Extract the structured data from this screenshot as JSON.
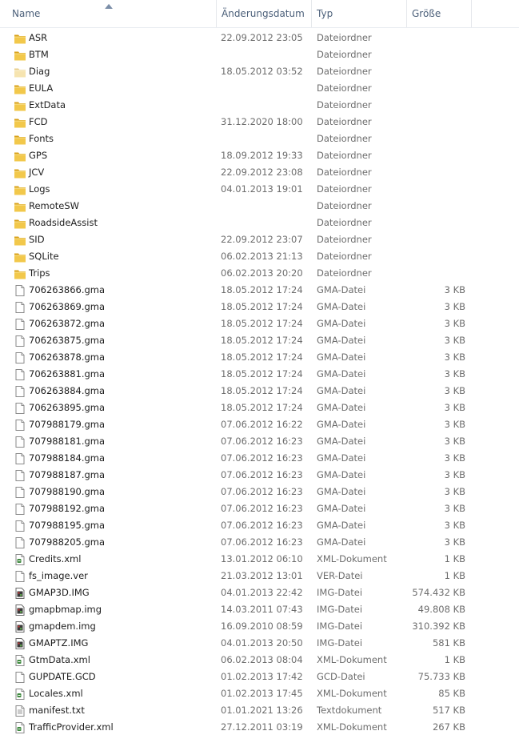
{
  "columns": {
    "name": "Name",
    "date": "Änderungsdatum",
    "type": "Typ",
    "size": "Größe"
  },
  "files": [
    {
      "name": "ASR",
      "date": "22.09.2012 23:05",
      "type": "Dateiordner",
      "size": "",
      "icon": "folder"
    },
    {
      "name": "BTM",
      "date": "",
      "type": "Dateiordner",
      "size": "",
      "icon": "folder"
    },
    {
      "name": "Diag",
      "date": "18.05.2012 03:52",
      "type": "Dateiordner",
      "size": "",
      "icon": "folder-light"
    },
    {
      "name": "EULA",
      "date": "",
      "type": "Dateiordner",
      "size": "",
      "icon": "folder"
    },
    {
      "name": "ExtData",
      "date": "",
      "type": "Dateiordner",
      "size": "",
      "icon": "folder"
    },
    {
      "name": "FCD",
      "date": "31.12.2020 18:00",
      "type": "Dateiordner",
      "size": "",
      "icon": "folder"
    },
    {
      "name": "Fonts",
      "date": "",
      "type": "Dateiordner",
      "size": "",
      "icon": "folder"
    },
    {
      "name": "GPS",
      "date": "18.09.2012 19:33",
      "type": "Dateiordner",
      "size": "",
      "icon": "folder"
    },
    {
      "name": "JCV",
      "date": "22.09.2012 23:08",
      "type": "Dateiordner",
      "size": "",
      "icon": "folder"
    },
    {
      "name": "Logs",
      "date": "04.01.2013 19:01",
      "type": "Dateiordner",
      "size": "",
      "icon": "folder"
    },
    {
      "name": "RemoteSW",
      "date": "",
      "type": "Dateiordner",
      "size": "",
      "icon": "folder"
    },
    {
      "name": "RoadsideAssist",
      "date": "",
      "type": "Dateiordner",
      "size": "",
      "icon": "folder"
    },
    {
      "name": "SID",
      "date": "22.09.2012 23:07",
      "type": "Dateiordner",
      "size": "",
      "icon": "folder"
    },
    {
      "name": "SQLite",
      "date": "06.02.2013 21:13",
      "type": "Dateiordner",
      "size": "",
      "icon": "folder"
    },
    {
      "name": "Trips",
      "date": "06.02.2013 20:20",
      "type": "Dateiordner",
      "size": "",
      "icon": "folder"
    },
    {
      "name": "706263866.gma",
      "date": "18.05.2012 17:24",
      "type": "GMA-Datei",
      "size": "3 KB",
      "icon": "file"
    },
    {
      "name": "706263869.gma",
      "date": "18.05.2012 17:24",
      "type": "GMA-Datei",
      "size": "3 KB",
      "icon": "file"
    },
    {
      "name": "706263872.gma",
      "date": "18.05.2012 17:24",
      "type": "GMA-Datei",
      "size": "3 KB",
      "icon": "file"
    },
    {
      "name": "706263875.gma",
      "date": "18.05.2012 17:24",
      "type": "GMA-Datei",
      "size": "3 KB",
      "icon": "file"
    },
    {
      "name": "706263878.gma",
      "date": "18.05.2012 17:24",
      "type": "GMA-Datei",
      "size": "3 KB",
      "icon": "file"
    },
    {
      "name": "706263881.gma",
      "date": "18.05.2012 17:24",
      "type": "GMA-Datei",
      "size": "3 KB",
      "icon": "file"
    },
    {
      "name": "706263884.gma",
      "date": "18.05.2012 17:24",
      "type": "GMA-Datei",
      "size": "3 KB",
      "icon": "file"
    },
    {
      "name": "706263895.gma",
      "date": "18.05.2012 17:24",
      "type": "GMA-Datei",
      "size": "3 KB",
      "icon": "file"
    },
    {
      "name": "707988179.gma",
      "date": "07.06.2012 16:22",
      "type": "GMA-Datei",
      "size": "3 KB",
      "icon": "file"
    },
    {
      "name": "707988181.gma",
      "date": "07.06.2012 16:23",
      "type": "GMA-Datei",
      "size": "3 KB",
      "icon": "file"
    },
    {
      "name": "707988184.gma",
      "date": "07.06.2012 16:23",
      "type": "GMA-Datei",
      "size": "3 KB",
      "icon": "file"
    },
    {
      "name": "707988187.gma",
      "date": "07.06.2012 16:23",
      "type": "GMA-Datei",
      "size": "3 KB",
      "icon": "file"
    },
    {
      "name": "707988190.gma",
      "date": "07.06.2012 16:23",
      "type": "GMA-Datei",
      "size": "3 KB",
      "icon": "file"
    },
    {
      "name": "707988192.gma",
      "date": "07.06.2012 16:23",
      "type": "GMA-Datei",
      "size": "3 KB",
      "icon": "file"
    },
    {
      "name": "707988195.gma",
      "date": "07.06.2012 16:23",
      "type": "GMA-Datei",
      "size": "3 KB",
      "icon": "file"
    },
    {
      "name": "707988205.gma",
      "date": "07.06.2012 16:23",
      "type": "GMA-Datei",
      "size": "3 KB",
      "icon": "file"
    },
    {
      "name": "Credits.xml",
      "date": "13.01.2012 06:10",
      "type": "XML-Dokument",
      "size": "1 KB",
      "icon": "xml"
    },
    {
      "name": "fs_image.ver",
      "date": "21.03.2012 13:01",
      "type": "VER-Datei",
      "size": "1 KB",
      "icon": "file"
    },
    {
      "name": "GMAP3D.IMG",
      "date": "04.01.2013 22:42",
      "type": "IMG-Datei",
      "size": "574.432 KB",
      "icon": "img"
    },
    {
      "name": "gmapbmap.img",
      "date": "14.03.2011 07:43",
      "type": "IMG-Datei",
      "size": "49.808 KB",
      "icon": "img"
    },
    {
      "name": "gmapdem.img",
      "date": "16.09.2010 08:59",
      "type": "IMG-Datei",
      "size": "310.392 KB",
      "icon": "img"
    },
    {
      "name": "GMAPTZ.IMG",
      "date": "04.01.2013 20:50",
      "type": "IMG-Datei",
      "size": "581 KB",
      "icon": "img"
    },
    {
      "name": "GtmData.xml",
      "date": "06.02.2013 08:04",
      "type": "XML-Dokument",
      "size": "1 KB",
      "icon": "xml"
    },
    {
      "name": "GUPDATE.GCD",
      "date": "01.02.2013 17:42",
      "type": "GCD-Datei",
      "size": "75.733 KB",
      "icon": "file"
    },
    {
      "name": "Locales.xml",
      "date": "01.02.2013 17:45",
      "type": "XML-Dokument",
      "size": "85 KB",
      "icon": "xml"
    },
    {
      "name": "manifest.txt",
      "date": "01.01.2021 13:26",
      "type": "Textdokument",
      "size": "517 KB",
      "icon": "txt"
    },
    {
      "name": "TrafficProvider.xml",
      "date": "27.12.2011 03:19",
      "type": "XML-Dokument",
      "size": "267 KB",
      "icon": "xml"
    }
  ]
}
